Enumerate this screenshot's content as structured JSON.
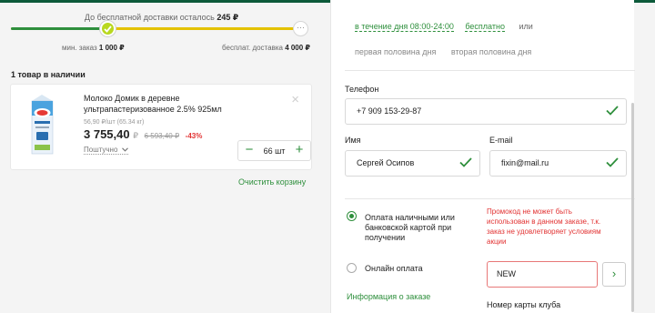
{
  "delivery_progress": {
    "free_left_label": "До бесплатной доставки осталось",
    "free_left_amount": "245 ₽",
    "progress_fraction": 0.34,
    "min_order_label": "мин. заказ",
    "min_order_amount": "1 000 ₽",
    "free_delivery_label": "бесплат. доставка",
    "free_delivery_amount": "4 000 ₽",
    "end_marker": "···"
  },
  "cart": {
    "in_stock_heading": "1 товар в наличии",
    "item": {
      "name": "Молоко Домик в деревне ультрапастеризованное 2.5% 925мл",
      "unit_price": "56,90 ₽/шт (65.34 кг)",
      "price": "3 755,40",
      "currency": "₽",
      "old_price": "6 593,40 ₽",
      "discount": "-43%",
      "usually_label": "Поштучно",
      "quantity": "66 шт",
      "minus": "−",
      "plus": "+",
      "remove": "×"
    },
    "clear_cart": "Очистить корзину"
  },
  "delivery_time": {
    "selected_slot": "в течение дня 08:00-24:00",
    "selected_price": "бесплатно",
    "or": "или",
    "options": [
      "первая половина дня",
      "вторая половина дня"
    ]
  },
  "contacts": {
    "phone_label": "Телефон",
    "phone_value": "+7 909 153-29-87",
    "name_label": "Имя",
    "name_value": "Сергей Осипов",
    "email_label": "E-mail",
    "email_value": "fixin@mail.ru"
  },
  "payment": {
    "cash_label": "Оплата наличными или банковской картой при получении",
    "online_label": "Онлайн оплата",
    "selected": "cash"
  },
  "promo": {
    "error": "Промокод не может быть использован в данном заказе, т.к. заказ не удовлетворяет условиям акции",
    "value": "NEW",
    "submit": "›"
  },
  "order_info_link": "Информация о заказе",
  "card_number_label": "Номер карты клуба",
  "colors": {
    "accent_green": "#2e8f3c",
    "error_red": "#e23333",
    "progress_yellow": "#e4c200"
  }
}
